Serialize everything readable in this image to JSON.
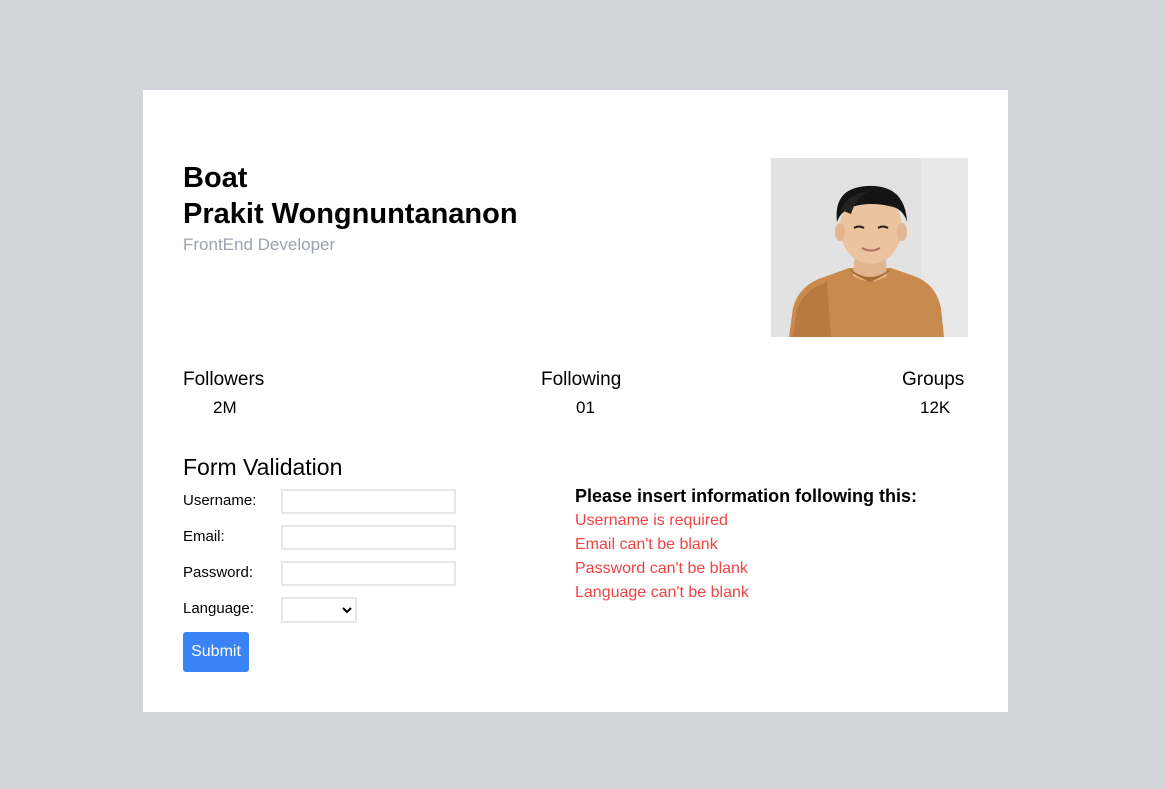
{
  "profile": {
    "nickname": "Boat",
    "full_name": "Prakit Wongnuntananon",
    "role": "FrontEnd Developer"
  },
  "stats": [
    {
      "label": "Followers",
      "value": "2M"
    },
    {
      "label": "Following",
      "value": "01"
    },
    {
      "label": "Groups",
      "value": "12K"
    }
  ],
  "form": {
    "title": "Form Validation",
    "fields": [
      {
        "label": "Username:",
        "value": ""
      },
      {
        "label": "Email:",
        "value": ""
      },
      {
        "label": "Password:",
        "value": ""
      },
      {
        "label": "Language:",
        "value": ""
      }
    ],
    "submit_label": "Submit"
  },
  "errors": {
    "title": "Please insert information following this:",
    "items": [
      "Username is required",
      "Email can't be blank",
      "Password can't be blank",
      "Language can't be blank"
    ]
  },
  "colors": {
    "background": "#d1d5db",
    "card": "#ffffff",
    "accent": "#3b82f6",
    "error": "#ef4444",
    "muted": "#9ca3af"
  }
}
